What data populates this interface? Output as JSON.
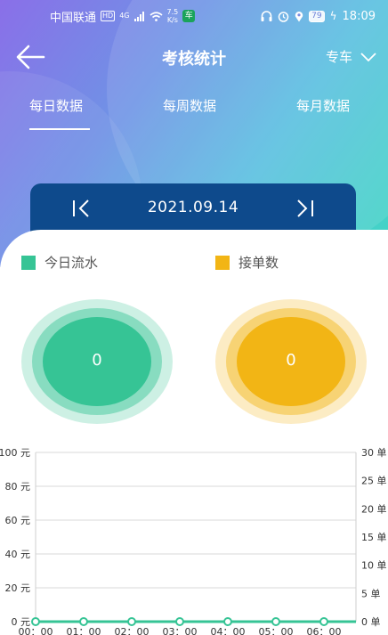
{
  "status_bar": {
    "carrier": "中国联通",
    "hd": "HD",
    "network": "4G",
    "speed_value": "7.5",
    "speed_unit": "K/s",
    "app_badge": "车",
    "battery": "79",
    "time": "18:09"
  },
  "nav": {
    "title": "考核统计",
    "vehicle_type": "专车"
  },
  "tabs": [
    {
      "label": "每日数据",
      "active": true
    },
    {
      "label": "每周数据",
      "active": false
    },
    {
      "label": "每月数据",
      "active": false
    }
  ],
  "date_bar": {
    "date": "2021.09.14"
  },
  "legend": [
    {
      "label": "今日流水",
      "color": "#36c495"
    },
    {
      "label": "接单数",
      "color": "#f2b515"
    }
  ],
  "circles": [
    {
      "value": "0",
      "color": "#36c495"
    },
    {
      "value": "0",
      "color": "#f2b515"
    }
  ],
  "chart_data": {
    "type": "line",
    "x": [
      "00：00",
      "01：00",
      "02：00",
      "03：00",
      "04：00",
      "05：00",
      "06：00"
    ],
    "series": [
      {
        "values": [
          0,
          0,
          0,
          0,
          0,
          0,
          0
        ],
        "color": "#36c495"
      }
    ],
    "y_left": {
      "ticks": [
        "0 元",
        "20 元",
        "40 元",
        "60 元",
        "80 元",
        "100 元"
      ],
      "ylim": [
        0,
        100
      ]
    },
    "y_right": {
      "ticks": [
        "0 单",
        "5 单",
        "10 单",
        "15 单",
        "20 单",
        "25 单",
        "30 单"
      ],
      "ylim": [
        0,
        30
      ]
    },
    "grid": true
  }
}
